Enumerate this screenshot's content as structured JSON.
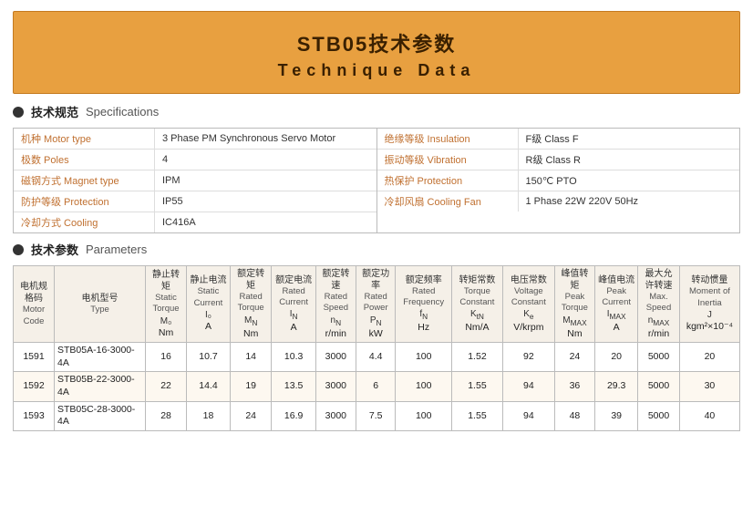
{
  "header": {
    "title_cn": "STB05技术参数",
    "title_en": "Technique  Data"
  },
  "specs_section": {
    "bullet": true,
    "label_cn": "技术规范",
    "label_en": "Specifications",
    "left_rows": [
      {
        "label_cn": "机种",
        "label_en": "Motor type",
        "value": "3 Phase PM Synchronous Servo Motor"
      },
      {
        "label_cn": "极数",
        "label_en": "Poles",
        "value": "4"
      },
      {
        "label_cn": "磁钢方式",
        "label_en": "Magnet type",
        "value": "IPM"
      },
      {
        "label_cn": "防护等级",
        "label_en": "Protection",
        "value": "IP55"
      },
      {
        "label_cn": "冷却方式",
        "label_en": "Cooling",
        "value": "IC416A"
      }
    ],
    "right_rows": [
      {
        "label_cn": "绝缘等级",
        "label_en": "Insulation",
        "value": "F级  Class F"
      },
      {
        "label_cn": "振动等级",
        "label_en": "Vibration",
        "value": "R级  Class R"
      },
      {
        "label_cn": "热保护",
        "label_en": "Protection",
        "value": "150℃ PTO"
      },
      {
        "label_cn": "冷却风扇",
        "label_en": "Cooling Fan",
        "value": "1 Phase  22W  220V  50Hz"
      }
    ]
  },
  "params_section": {
    "bullet": true,
    "label_cn": "技术参数",
    "label_en": "Parameters",
    "table": {
      "col_headers": [
        {
          "cn": "静止转矩",
          "en": "Static Torque",
          "sym": "M₀",
          "unit": "Nm"
        },
        {
          "cn": "静止电流",
          "en": "Static Current",
          "sym": "I₀",
          "unit": "A"
        },
        {
          "cn": "额定转矩",
          "en": "Rated Torque",
          "sym": "MN",
          "unit": "Nm"
        },
        {
          "cn": "额定电流",
          "en": "Rated Current",
          "sym": "IN",
          "unit": "A"
        },
        {
          "cn": "额定转速",
          "en": "Rated Speed",
          "sym": "nN",
          "unit": "r/min"
        },
        {
          "cn": "额定功率",
          "en": "Rated Power",
          "sym": "PN",
          "unit": "kW"
        },
        {
          "cn": "额定频率",
          "en": "Rated Frequency",
          "sym": "fN",
          "unit": "Hz"
        },
        {
          "cn": "转矩常数",
          "en": "Torque Constant",
          "sym": "KtN",
          "unit": "Nm/A"
        },
        {
          "cn": "电压常数",
          "en": "Voltage Constant",
          "sym": "Ke",
          "unit": "V/krpm"
        },
        {
          "cn": "峰值转矩",
          "en": "Peak Torque",
          "sym": "MMAX",
          "unit": "Nm"
        },
        {
          "cn": "峰值电流",
          "en": "Peak Current",
          "sym": "IMAX",
          "unit": "A"
        },
        {
          "cn": "最大允许转速",
          "en": "Max. Speed",
          "sym": "nMAX",
          "unit": "r/min"
        },
        {
          "cn": "转动惯量",
          "en": "Moment of Inertia",
          "sym": "J",
          "unit": "kgm²×10⁻⁴"
        }
      ],
      "row_headers": [
        {
          "top_cn": "电机规格码",
          "top_en": "Motor Code"
        },
        {
          "top_cn": "电机型号",
          "top_en": "Type"
        }
      ],
      "rows": [
        {
          "code": "1591",
          "type": "STB05A-16-3000-4A",
          "vals": [
            16,
            10.7,
            14,
            10.3,
            3000,
            4.4,
            100,
            1.52,
            92,
            24,
            20.0,
            5000,
            20
          ]
        },
        {
          "code": "1592",
          "type": "STB05B-22-3000-4A",
          "vals": [
            22,
            14.4,
            19,
            13.5,
            3000,
            6.0,
            100,
            1.55,
            94,
            36,
            29.3,
            5000,
            30
          ]
        },
        {
          "code": "1593",
          "type": "STB05C-28-3000-4A",
          "vals": [
            28,
            18.0,
            24,
            16.9,
            3000,
            7.5,
            100,
            1.55,
            94,
            48,
            39.0,
            5000,
            40
          ]
        }
      ]
    }
  }
}
